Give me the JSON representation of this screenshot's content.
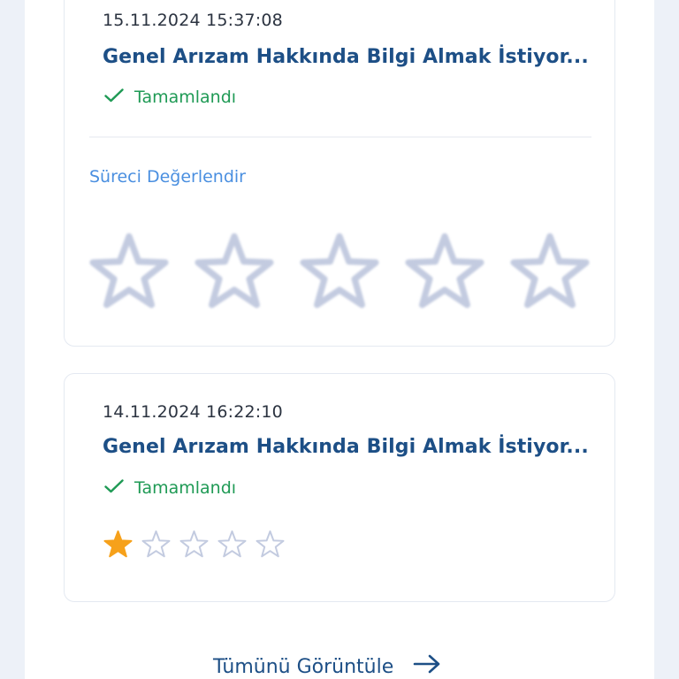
{
  "requests": [
    {
      "timestamp": "15.11.2024 15:37:08",
      "subject": "Genel Arızam Hakkında Bilgi Almak İstiyor...",
      "status": "Tamamlandı",
      "rate_label": "Süreci Değerlendir",
      "rating": 0,
      "max_rating": 5
    },
    {
      "timestamp": "14.11.2024 16:22:10",
      "subject": "Genel Arızam Hakkında Bilgi Almak İstiyor...",
      "status": "Tamamlandı",
      "rating": 1,
      "max_rating": 5
    }
  ],
  "view_all_label": "Tümünü Görüntüle",
  "colors": {
    "status_green": "#1f9a55",
    "star_filled": "#f6a11b",
    "star_empty": "#c3cbe0",
    "link_blue": "#4a8fe0",
    "title_blue": "#1d4f86"
  },
  "icons": {
    "status": "check-icon",
    "star": "star-icon",
    "arrow": "arrow-right-icon"
  }
}
